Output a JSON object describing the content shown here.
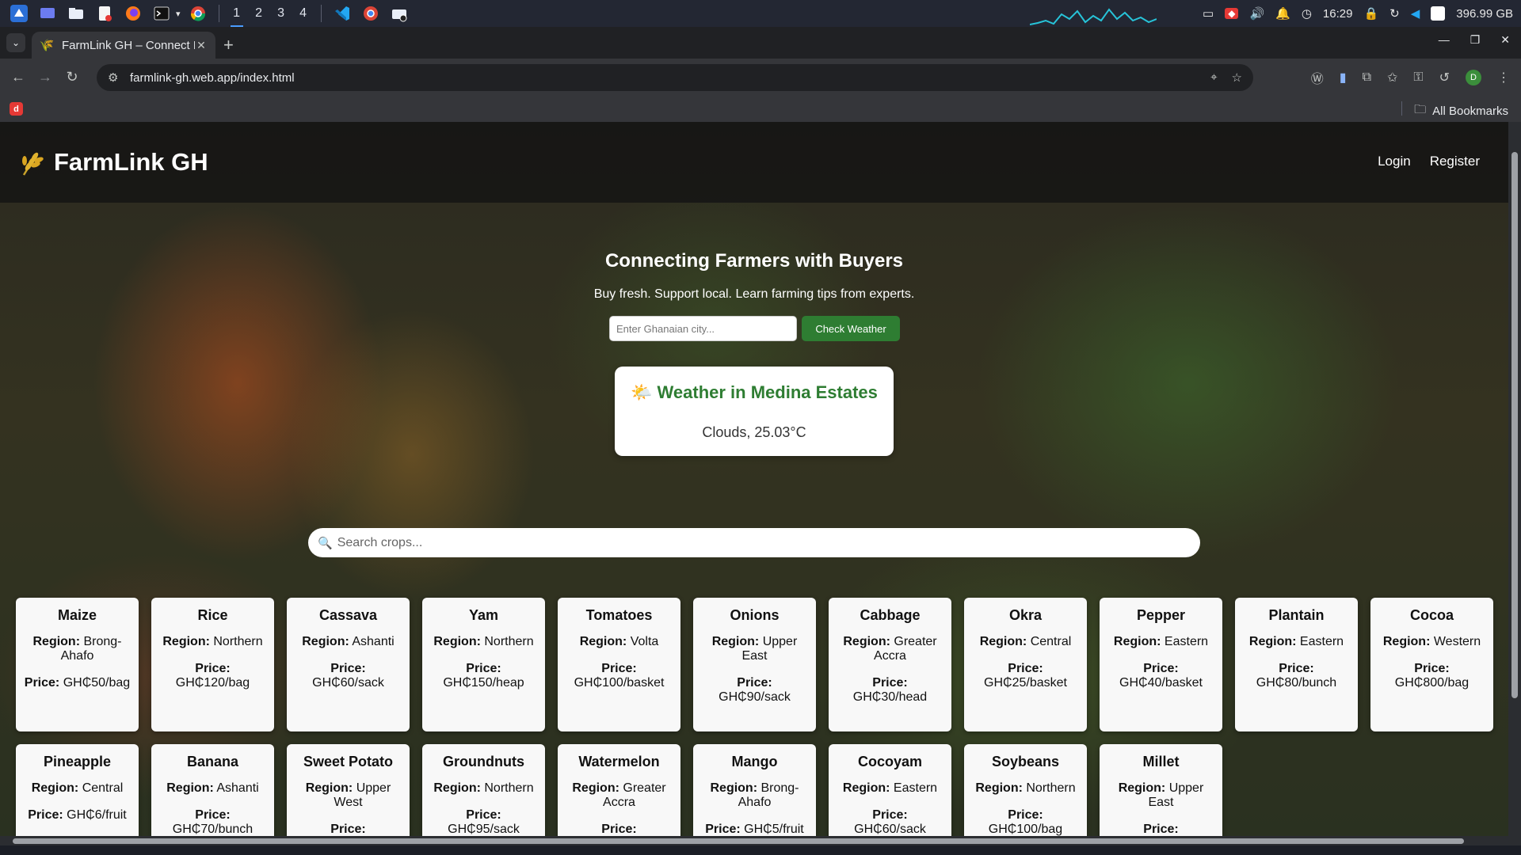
{
  "taskbar": {
    "workspaces": [
      "1",
      "2",
      "3",
      "4"
    ],
    "time": "16:29",
    "disk": "396.99 GB"
  },
  "browser": {
    "tab_title": "FarmLink GH – Connect Fa",
    "url": "farmlink-gh.web.app/index.html",
    "bookmarks_label": "All Bookmarks",
    "profile_initial": "D",
    "bookmark_app_letter": "d"
  },
  "site": {
    "logo_emoji": "🌾",
    "title": "FarmLink GH",
    "nav": {
      "login": "Login",
      "register": "Register"
    }
  },
  "hero": {
    "title": "Connecting Farmers with Buyers",
    "subtitle": "Buy fresh. Support local. Learn farming tips from experts.",
    "city_placeholder": "Enter Ghanaian city...",
    "weather_button": "Check Weather"
  },
  "weather": {
    "icon": "🌤️",
    "title": "Weather in Medina Estates",
    "description": "Clouds, 25.03°C"
  },
  "search": {
    "icon": "🔍",
    "placeholder": "Search crops..."
  },
  "labels": {
    "region": "Region:",
    "price": "Price:"
  },
  "crops": [
    {
      "name": "Maize",
      "region": "Brong-Ahafo",
      "price": "GH₵50/bag"
    },
    {
      "name": "Rice",
      "region": "Northern",
      "price": "GH₵120/bag"
    },
    {
      "name": "Cassava",
      "region": "Ashanti",
      "price": "GH₵60/sack"
    },
    {
      "name": "Yam",
      "region": "Northern",
      "price": "GH₵150/heap"
    },
    {
      "name": "Tomatoes",
      "region": "Volta",
      "price": "GH₵100/basket"
    },
    {
      "name": "Onions",
      "region": "Upper East",
      "price": "GH₵90/sack"
    },
    {
      "name": "Cabbage",
      "region": "Greater Accra",
      "price": "GH₵30/head"
    },
    {
      "name": "Okra",
      "region": "Central",
      "price": "GH₵25/basket"
    },
    {
      "name": "Pepper",
      "region": "Eastern",
      "price": "GH₵40/basket"
    },
    {
      "name": "Plantain",
      "region": "Eastern",
      "price": "GH₵80/bunch"
    },
    {
      "name": "Cocoa",
      "region": "Western",
      "price": "GH₵800/bag"
    },
    {
      "name": "Pineapple",
      "region": "Central",
      "price": "GH₵6/fruit"
    },
    {
      "name": "Banana",
      "region": "Ashanti",
      "price": "GH₵70/bunch"
    },
    {
      "name": "Sweet Potato",
      "region": "Upper West",
      "price": ""
    },
    {
      "name": "Groundnuts",
      "region": "Northern",
      "price": "GH₵95/sack"
    },
    {
      "name": "Watermelon",
      "region": "Greater Accra",
      "price": ""
    },
    {
      "name": "Mango",
      "region": "Brong-Ahafo",
      "price": "GH₵5/fruit"
    },
    {
      "name": "Cocoyam",
      "region": "Eastern",
      "price": "GH₵60/sack"
    },
    {
      "name": "Soybeans",
      "region": "Northern",
      "price": "GH₵100/bag"
    },
    {
      "name": "Millet",
      "region": "Upper East",
      "price": ""
    }
  ]
}
